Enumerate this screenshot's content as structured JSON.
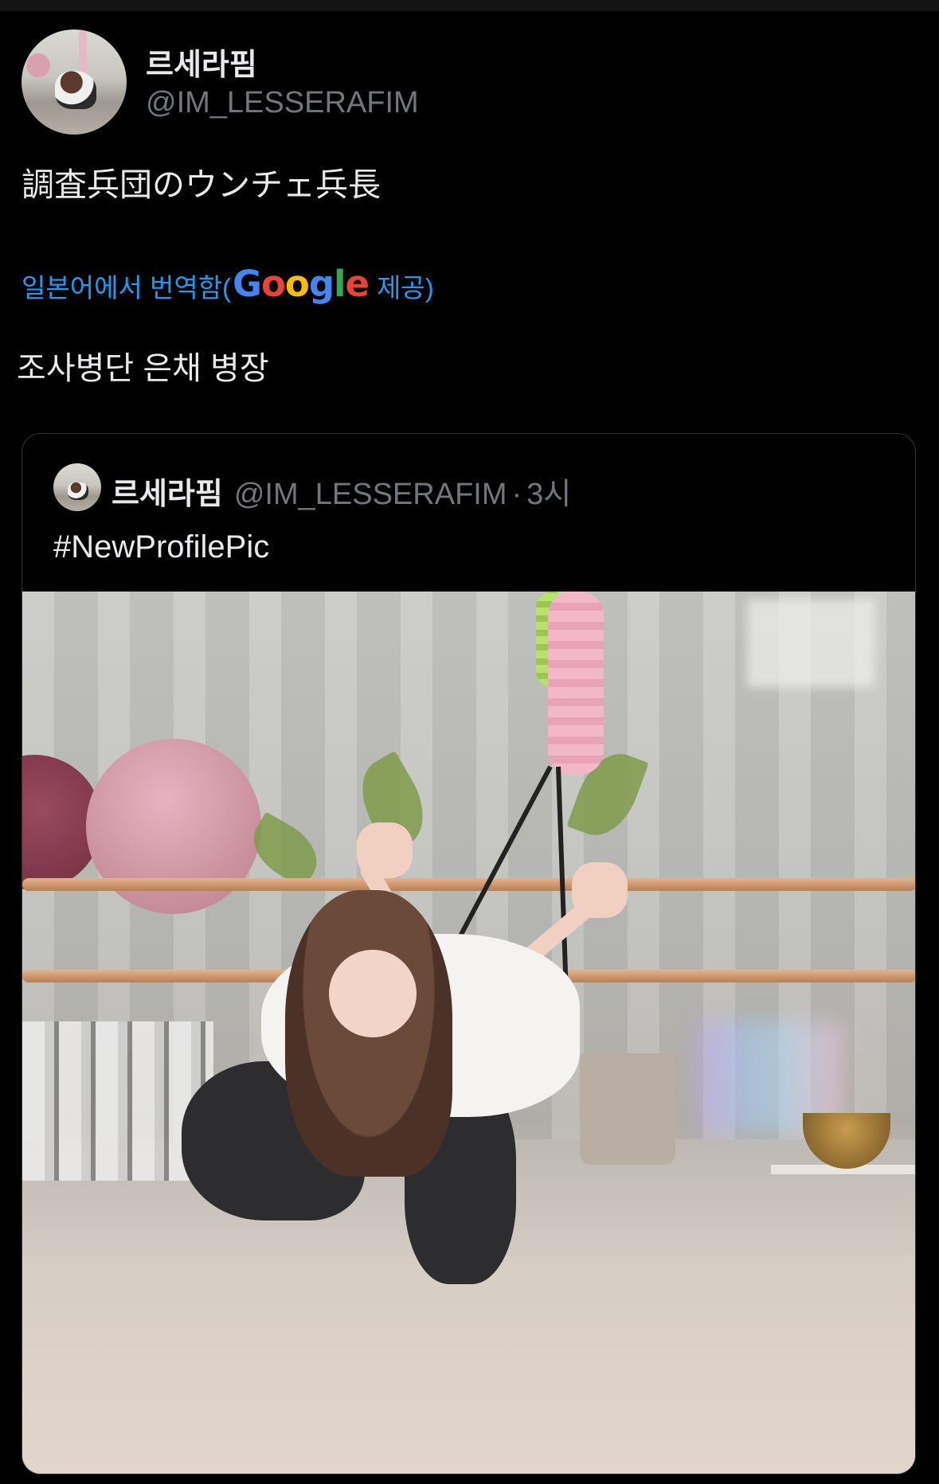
{
  "tweet": {
    "display_name": "르세라핌",
    "handle": "@IM_LESSERAFIM",
    "text": "調査兵団のウンチェ兵長",
    "translate_prefix": "일본어에서 번역함(",
    "translate_brand": [
      "G",
      "o",
      "o",
      "g",
      "l",
      "e"
    ],
    "translate_suffix": " 제공)",
    "translated_text": "조사병단 은채 병장"
  },
  "quote": {
    "display_name": "르세라핌",
    "handle": "@IM_LESSERAFIM",
    "separator": "·",
    "time": "3시",
    "text": "#NewProfilePic"
  },
  "colors": {
    "background": "#000000",
    "text_primary": "#e7e9ea",
    "text_secondary": "#71767b",
    "link": "#1d9bf0",
    "border": "#2f3336"
  }
}
